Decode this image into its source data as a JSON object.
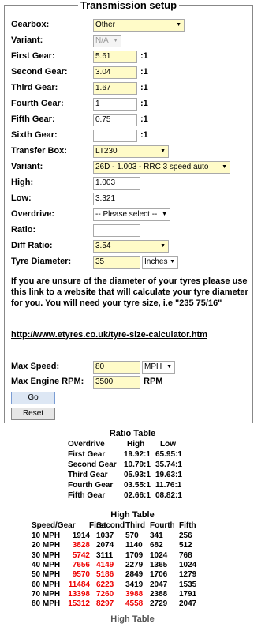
{
  "form": {
    "title": "Transmission setup",
    "gearbox": {
      "label": "Gearbox:",
      "value": "Other"
    },
    "variant1": {
      "label": "Variant:",
      "value": "N/A"
    },
    "gears": [
      {
        "label": "First Gear:",
        "value": "5.61",
        "unit": ":1"
      },
      {
        "label": "Second Gear:",
        "value": "3.04",
        "unit": ":1"
      },
      {
        "label": "Third Gear:",
        "value": "1.67",
        "unit": ":1"
      },
      {
        "label": "Fourth Gear:",
        "value": "1",
        "unit": ":1"
      },
      {
        "label": "Fifth Gear:",
        "value": "0.75",
        "unit": ":1"
      },
      {
        "label": "Sixth Gear:",
        "value": "",
        "unit": ":1"
      }
    ],
    "transfer_box": {
      "label": "Transfer Box:",
      "value": "LT230"
    },
    "variant2": {
      "label": "Variant:",
      "value": "26D - 1.003 - RRC 3 speed auto"
    },
    "high": {
      "label": "High:",
      "value": "1.003"
    },
    "low": {
      "label": "Low:",
      "value": "3.321"
    },
    "overdrive": {
      "label": "Overdrive:",
      "value": "-- Please select --"
    },
    "ratio": {
      "label": "Ratio:",
      "value": ""
    },
    "diff_ratio": {
      "label": "Diff Ratio:",
      "value": "3.54"
    },
    "tyre_diameter": {
      "label": "Tyre Diameter:",
      "value": "35",
      "unit": "Inches"
    },
    "help_text": "If you are unsure of the diameter of your tyres please use this link to a website that will calculate your tyre diameter for you. You will need your tyre size, i.e \"235 75/16\"",
    "link": "http://www.etyres.co.uk/tyre-size-calculator.htm",
    "max_speed": {
      "label": "Max Speed:",
      "value": "80",
      "unit": "MPH"
    },
    "max_rpm": {
      "label": "Max Engine RPM:",
      "value": "3500",
      "unit": "RPM"
    },
    "go_label": "Go",
    "reset_label": "Reset"
  },
  "ratio_table": {
    "title": "Ratio Table",
    "headers": [
      "Overdrive",
      "High",
      "Low"
    ],
    "rows": [
      [
        "First Gear",
        "19.92:1",
        "65.95:1"
      ],
      [
        "Second Gear",
        "10.79:1",
        "35.74:1"
      ],
      [
        "Third Gear",
        "05.93:1",
        "19.63:1"
      ],
      [
        "Fourth Gear",
        "03.55:1",
        "11.76:1"
      ],
      [
        "Fifth Gear",
        "02.66:1",
        "08.82:1"
      ]
    ]
  },
  "high_table": {
    "title": "High Table",
    "caption": "High Table",
    "headers": [
      "Speed/Gear",
      "First",
      "Second",
      "Third",
      "Fourth",
      "Fifth"
    ],
    "rows": [
      [
        "10 MPH",
        "1914",
        "1037",
        "570",
        "341",
        "256"
      ],
      [
        "20 MPH",
        "3828",
        "2074",
        "1140",
        "682",
        "512"
      ],
      [
        "30 MPH",
        "5742",
        "3111",
        "1709",
        "1024",
        "768"
      ],
      [
        "40 MPH",
        "7656",
        "4149",
        "2279",
        "1365",
        "1024"
      ],
      [
        "50 MPH",
        "9570",
        "5186",
        "2849",
        "1706",
        "1279"
      ],
      [
        "60 MPH",
        "11484",
        "6223",
        "3419",
        "2047",
        "1535"
      ],
      [
        "70 MPH",
        "13398",
        "7260",
        "3988",
        "2388",
        "1791"
      ],
      [
        "80 MPH",
        "15312",
        "8297",
        "4558",
        "2729",
        "2047"
      ]
    ],
    "over_limit_color": "#ee0000"
  }
}
